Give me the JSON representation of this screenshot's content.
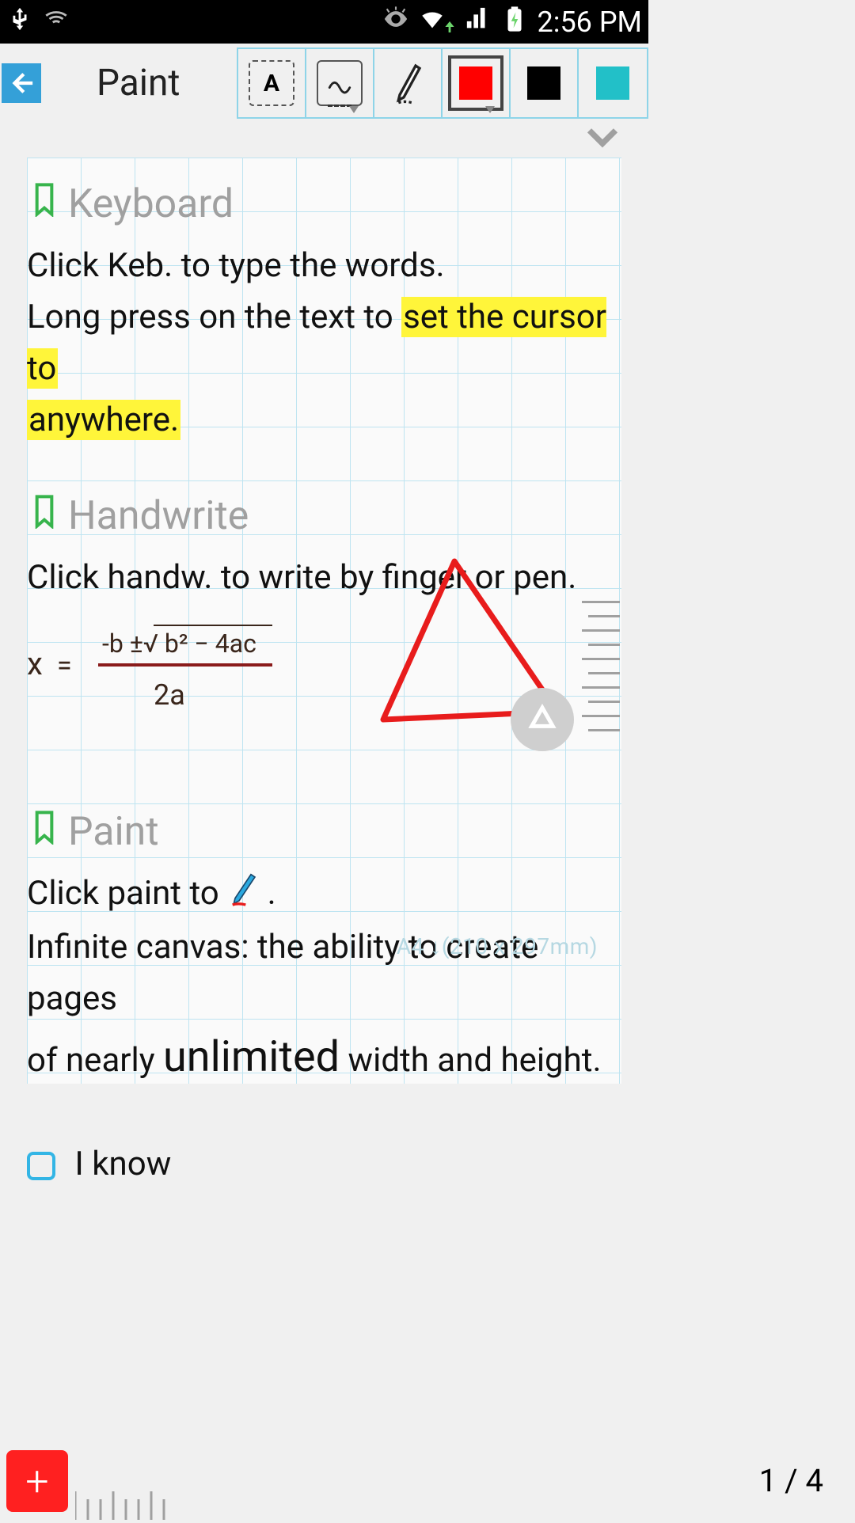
{
  "status": {
    "time": "2:56 PM"
  },
  "header": {
    "title": "Paint"
  },
  "toolbar": {
    "text_label": "A",
    "colors": {
      "selected": "#FF0000",
      "black": "#000000",
      "teal": "#22C0C8"
    }
  },
  "sections": {
    "keyboard": {
      "title": "Keyboard",
      "line1": "Click Keb. to type the words.",
      "line2_pre": "Long press on the text to ",
      "line2_hl1": "set the cursor to",
      "line2_hl2": "anywhere."
    },
    "handwrite": {
      "title": "Handwrite",
      "line1": "Click handw. to write by finger or pen.",
      "formula_numerator": "-b ± √(b² − 4ac)",
      "formula_denominator": "2a",
      "formula_lhs": "x ="
    },
    "paint": {
      "title": "Paint",
      "line1_pre": "Click paint to ",
      "line1_post": " .",
      "line2_a": "Infinite canvas: the ability to create pages",
      "line2_b_pre": "of nearly ",
      "line2_b_big": "unlimited",
      "line2_b_post": " width and height."
    },
    "iknow": {
      "label": "I know"
    }
  },
  "page_size_badge": "A4 ↓(210 x 297mm)",
  "page_indicator": "1 / 4"
}
